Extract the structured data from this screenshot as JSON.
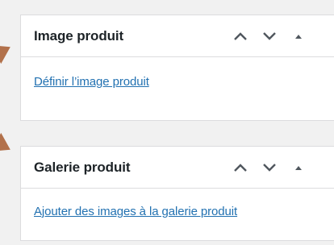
{
  "metaboxes": [
    {
      "title": "Image produit",
      "link": "Définir l’image produit"
    },
    {
      "title": "Galerie produit",
      "link": "Ajouter des images à la galerie produit"
    }
  ],
  "icons": {
    "move_up": "chevron-up-icon",
    "move_down": "chevron-down-icon",
    "toggle": "triangle-up-icon"
  },
  "colors": {
    "background": "#f1f1f1",
    "panel": "#ffffff",
    "border": "#dcdcde",
    "title_text": "#1d2327",
    "link": "#2271b1",
    "pointer_arrow": "#b2714b"
  }
}
